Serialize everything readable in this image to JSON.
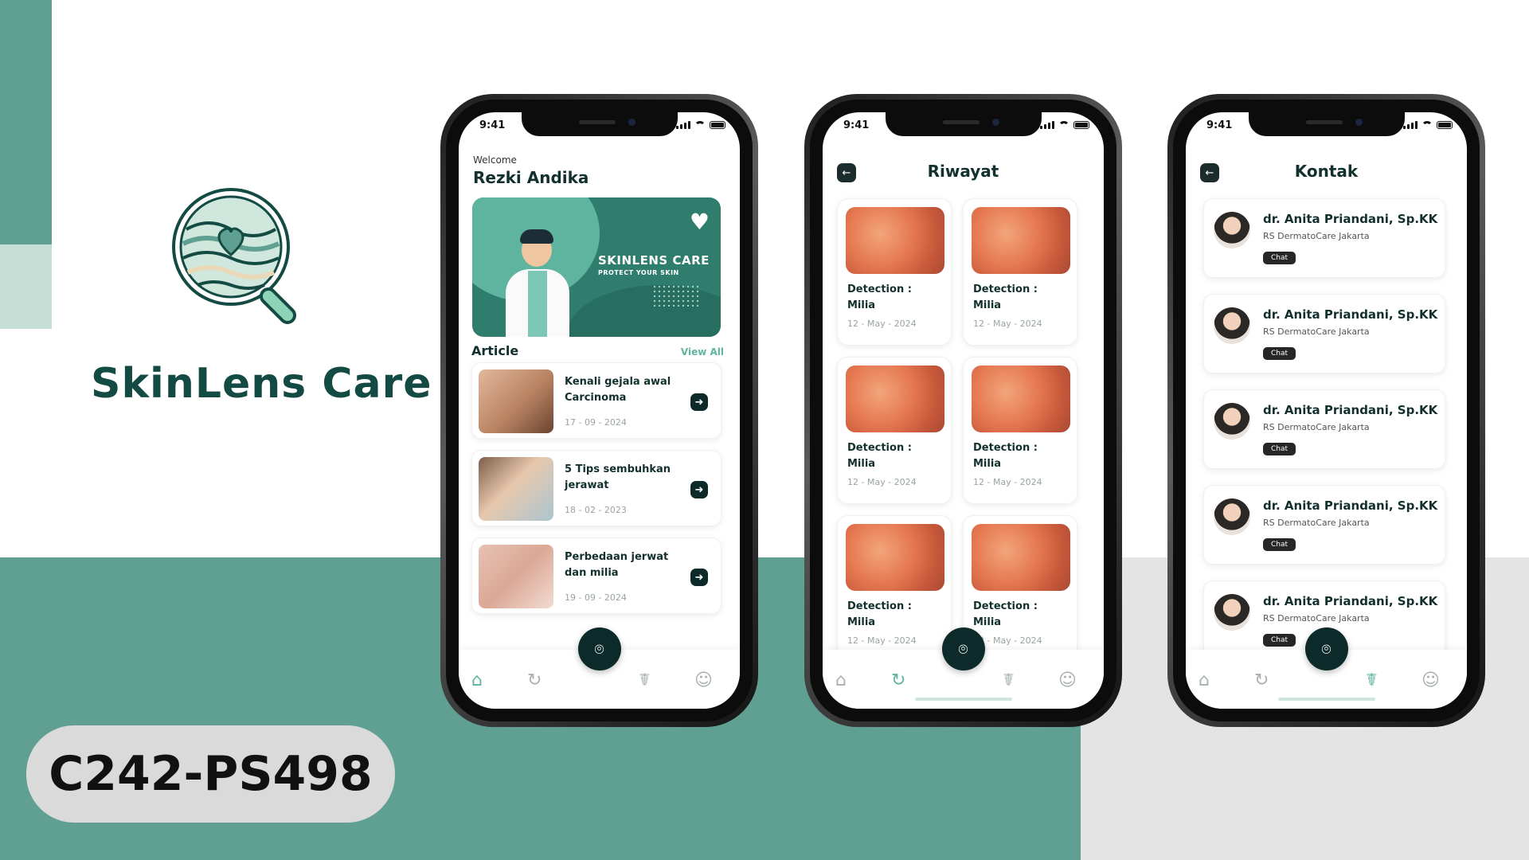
{
  "brand": {
    "name": "SkinLens Care",
    "code": "C242-PS498"
  },
  "colors": {
    "accent": "#5fa092",
    "accent_light": "#c5ded6",
    "dark": "#0d2a2a",
    "link": "#5fb4a0"
  },
  "status": {
    "time": "9:41"
  },
  "home": {
    "welcome": "Welcome",
    "user": "Rezki Andika",
    "banner_title": "SKINLENS CARE",
    "banner_sub": "PROTECT YOUR SKIN",
    "section": "Article",
    "view_all": "View All",
    "articles": [
      {
        "title": "Kenali gejala awal Carcinoma",
        "date": "17 - 09 - 2024"
      },
      {
        "title": "5 Tips sembuhkan jerawat",
        "date": "18 - 02 - 2023"
      },
      {
        "title": "Perbedaan jerwat dan milia",
        "date": "19 - 09 - 2024"
      }
    ]
  },
  "history": {
    "title": "Riwayat",
    "items": [
      {
        "label": "Detection :",
        "value": "Milia",
        "date": "12 - May - 2024"
      },
      {
        "label": "Detection :",
        "value": "Milia",
        "date": "12 - May - 2024"
      },
      {
        "label": "Detection :",
        "value": "Milia",
        "date": "12 - May - 2024"
      },
      {
        "label": "Detection :",
        "value": "Milia",
        "date": "12 - May - 2024"
      },
      {
        "label": "Detection :",
        "value": "Milia",
        "date": "12 - May - 2024"
      },
      {
        "label": "Detection :",
        "value": "Milia",
        "date": "12 - May - 2024"
      }
    ]
  },
  "contacts": {
    "title": "Kontak",
    "items": [
      {
        "name": "dr. Anita Priandani, Sp.KK",
        "hospital": "RS DermatoCare Jakarta",
        "chat": "Chat"
      },
      {
        "name": "dr. Anita Priandani, Sp.KK",
        "hospital": "RS DermatoCare Jakarta",
        "chat": "Chat"
      },
      {
        "name": "dr. Anita Priandani, Sp.KK",
        "hospital": "RS DermatoCare Jakarta",
        "chat": "Chat"
      },
      {
        "name": "dr. Anita Priandani, Sp.KK",
        "hospital": "RS DermatoCare Jakarta",
        "chat": "Chat"
      },
      {
        "name": "dr. Anita Priandani, Sp.KK",
        "hospital": "RS DermatoCare Jakarta",
        "chat": "Chat"
      }
    ]
  },
  "icons": {
    "nav": [
      "home-icon",
      "history-icon",
      "scan-icon",
      "stethoscope-icon",
      "profile-icon"
    ]
  }
}
